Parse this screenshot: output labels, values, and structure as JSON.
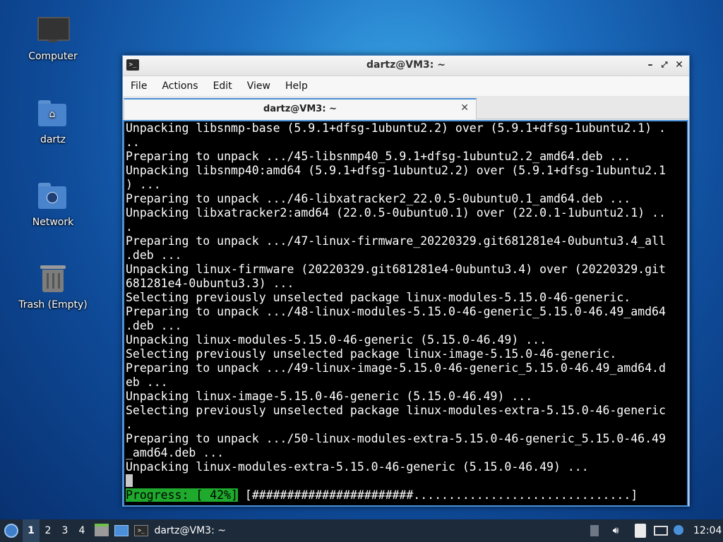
{
  "desktop": {
    "icons": [
      {
        "label": "Computer",
        "icon": "computer-icon"
      },
      {
        "label": "dartz",
        "icon": "home-folder-icon"
      },
      {
        "label": "Network",
        "icon": "network-folder-icon"
      },
      {
        "label": "Trash (Empty)",
        "icon": "trash-icon"
      }
    ]
  },
  "window": {
    "title": "dartz@VM3: ~",
    "menu": [
      "File",
      "Actions",
      "Edit",
      "View",
      "Help"
    ],
    "tab_label": "dartz@VM3: ~"
  },
  "terminal": {
    "lines": [
      "Unpacking libsnmp-base (5.9.1+dfsg-1ubuntu2.2) over (5.9.1+dfsg-1ubuntu2.1) .",
      "..",
      "Preparing to unpack .../45-libsnmp40_5.9.1+dfsg-1ubuntu2.2_amd64.deb ...",
      "Unpacking libsnmp40:amd64 (5.9.1+dfsg-1ubuntu2.2) over (5.9.1+dfsg-1ubuntu2.1",
      ") ...",
      "Preparing to unpack .../46-libxatracker2_22.0.5-0ubuntu0.1_amd64.deb ...",
      "Unpacking libxatracker2:amd64 (22.0.5-0ubuntu0.1) over (22.0.1-1ubuntu2.1) ..",
      ".",
      "Preparing to unpack .../47-linux-firmware_20220329.git681281e4-0ubuntu3.4_all",
      ".deb ...",
      "Unpacking linux-firmware (20220329.git681281e4-0ubuntu3.4) over (20220329.git",
      "681281e4-0ubuntu3.3) ...",
      "Selecting previously unselected package linux-modules-5.15.0-46-generic.",
      "Preparing to unpack .../48-linux-modules-5.15.0-46-generic_5.15.0-46.49_amd64",
      ".deb ...",
      "Unpacking linux-modules-5.15.0-46-generic (5.15.0-46.49) ...",
      "Selecting previously unselected package linux-image-5.15.0-46-generic.",
      "Preparing to unpack .../49-linux-image-5.15.0-46-generic_5.15.0-46.49_amd64.d",
      "eb ...",
      "Unpacking linux-image-5.15.0-46-generic (5.15.0-46.49) ...",
      "Selecting previously unselected package linux-modules-extra-5.15.0-46-generic",
      ".",
      "Preparing to unpack .../50-linux-modules-extra-5.15.0-46-generic_5.15.0-46.49",
      "_amd64.deb ...",
      "Unpacking linux-modules-extra-5.15.0-46-generic (5.15.0-46.49) ..."
    ],
    "progress_label": "Progress: [ 42%]",
    "progress_bar": " [#######################...............................]",
    "progress_percent": 42
  },
  "taskbar": {
    "workspaces": [
      "1",
      "2",
      "3",
      "4"
    ],
    "active_workspace": "1",
    "task_label": "dartz@VM3: ~",
    "clock": "12:04"
  }
}
